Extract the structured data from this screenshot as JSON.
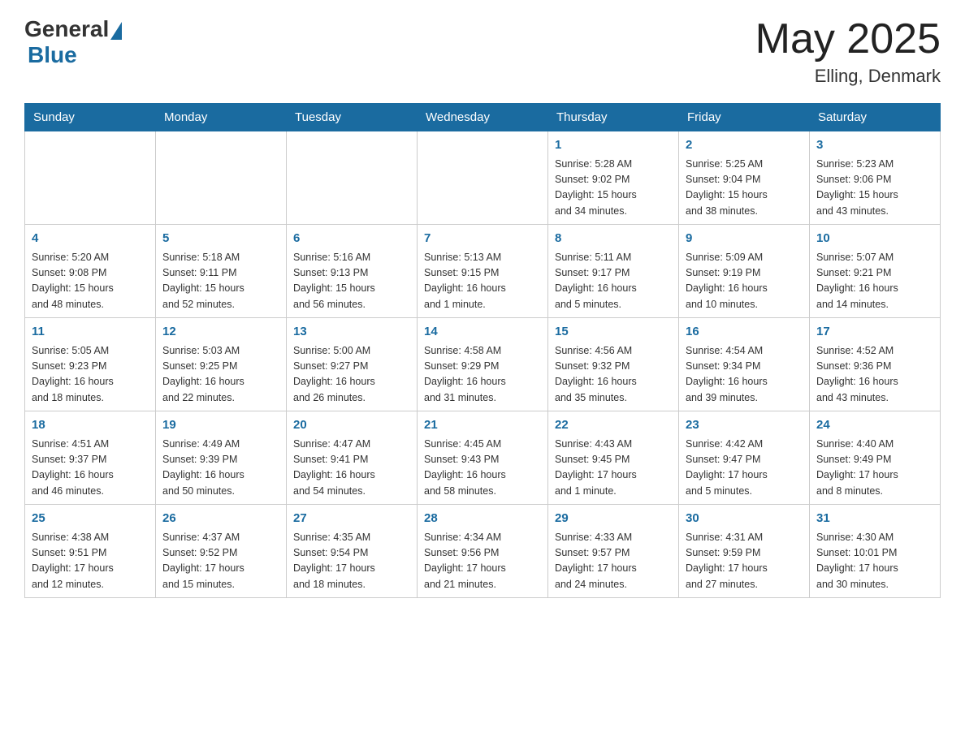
{
  "header": {
    "logo_general": "General",
    "logo_blue": "Blue",
    "month_year": "May 2025",
    "location": "Elling, Denmark"
  },
  "days_of_week": [
    "Sunday",
    "Monday",
    "Tuesday",
    "Wednesday",
    "Thursday",
    "Friday",
    "Saturday"
  ],
  "weeks": [
    [
      {
        "day": "",
        "info": ""
      },
      {
        "day": "",
        "info": ""
      },
      {
        "day": "",
        "info": ""
      },
      {
        "day": "",
        "info": ""
      },
      {
        "day": "1",
        "info": "Sunrise: 5:28 AM\nSunset: 9:02 PM\nDaylight: 15 hours\nand 34 minutes."
      },
      {
        "day": "2",
        "info": "Sunrise: 5:25 AM\nSunset: 9:04 PM\nDaylight: 15 hours\nand 38 minutes."
      },
      {
        "day": "3",
        "info": "Sunrise: 5:23 AM\nSunset: 9:06 PM\nDaylight: 15 hours\nand 43 minutes."
      }
    ],
    [
      {
        "day": "4",
        "info": "Sunrise: 5:20 AM\nSunset: 9:08 PM\nDaylight: 15 hours\nand 48 minutes."
      },
      {
        "day": "5",
        "info": "Sunrise: 5:18 AM\nSunset: 9:11 PM\nDaylight: 15 hours\nand 52 minutes."
      },
      {
        "day": "6",
        "info": "Sunrise: 5:16 AM\nSunset: 9:13 PM\nDaylight: 15 hours\nand 56 minutes."
      },
      {
        "day": "7",
        "info": "Sunrise: 5:13 AM\nSunset: 9:15 PM\nDaylight: 16 hours\nand 1 minute."
      },
      {
        "day": "8",
        "info": "Sunrise: 5:11 AM\nSunset: 9:17 PM\nDaylight: 16 hours\nand 5 minutes."
      },
      {
        "day": "9",
        "info": "Sunrise: 5:09 AM\nSunset: 9:19 PM\nDaylight: 16 hours\nand 10 minutes."
      },
      {
        "day": "10",
        "info": "Sunrise: 5:07 AM\nSunset: 9:21 PM\nDaylight: 16 hours\nand 14 minutes."
      }
    ],
    [
      {
        "day": "11",
        "info": "Sunrise: 5:05 AM\nSunset: 9:23 PM\nDaylight: 16 hours\nand 18 minutes."
      },
      {
        "day": "12",
        "info": "Sunrise: 5:03 AM\nSunset: 9:25 PM\nDaylight: 16 hours\nand 22 minutes."
      },
      {
        "day": "13",
        "info": "Sunrise: 5:00 AM\nSunset: 9:27 PM\nDaylight: 16 hours\nand 26 minutes."
      },
      {
        "day": "14",
        "info": "Sunrise: 4:58 AM\nSunset: 9:29 PM\nDaylight: 16 hours\nand 31 minutes."
      },
      {
        "day": "15",
        "info": "Sunrise: 4:56 AM\nSunset: 9:32 PM\nDaylight: 16 hours\nand 35 minutes."
      },
      {
        "day": "16",
        "info": "Sunrise: 4:54 AM\nSunset: 9:34 PM\nDaylight: 16 hours\nand 39 minutes."
      },
      {
        "day": "17",
        "info": "Sunrise: 4:52 AM\nSunset: 9:36 PM\nDaylight: 16 hours\nand 43 minutes."
      }
    ],
    [
      {
        "day": "18",
        "info": "Sunrise: 4:51 AM\nSunset: 9:37 PM\nDaylight: 16 hours\nand 46 minutes."
      },
      {
        "day": "19",
        "info": "Sunrise: 4:49 AM\nSunset: 9:39 PM\nDaylight: 16 hours\nand 50 minutes."
      },
      {
        "day": "20",
        "info": "Sunrise: 4:47 AM\nSunset: 9:41 PM\nDaylight: 16 hours\nand 54 minutes."
      },
      {
        "day": "21",
        "info": "Sunrise: 4:45 AM\nSunset: 9:43 PM\nDaylight: 16 hours\nand 58 minutes."
      },
      {
        "day": "22",
        "info": "Sunrise: 4:43 AM\nSunset: 9:45 PM\nDaylight: 17 hours\nand 1 minute."
      },
      {
        "day": "23",
        "info": "Sunrise: 4:42 AM\nSunset: 9:47 PM\nDaylight: 17 hours\nand 5 minutes."
      },
      {
        "day": "24",
        "info": "Sunrise: 4:40 AM\nSunset: 9:49 PM\nDaylight: 17 hours\nand 8 minutes."
      }
    ],
    [
      {
        "day": "25",
        "info": "Sunrise: 4:38 AM\nSunset: 9:51 PM\nDaylight: 17 hours\nand 12 minutes."
      },
      {
        "day": "26",
        "info": "Sunrise: 4:37 AM\nSunset: 9:52 PM\nDaylight: 17 hours\nand 15 minutes."
      },
      {
        "day": "27",
        "info": "Sunrise: 4:35 AM\nSunset: 9:54 PM\nDaylight: 17 hours\nand 18 minutes."
      },
      {
        "day": "28",
        "info": "Sunrise: 4:34 AM\nSunset: 9:56 PM\nDaylight: 17 hours\nand 21 minutes."
      },
      {
        "day": "29",
        "info": "Sunrise: 4:33 AM\nSunset: 9:57 PM\nDaylight: 17 hours\nand 24 minutes."
      },
      {
        "day": "30",
        "info": "Sunrise: 4:31 AM\nSunset: 9:59 PM\nDaylight: 17 hours\nand 27 minutes."
      },
      {
        "day": "31",
        "info": "Sunrise: 4:30 AM\nSunset: 10:01 PM\nDaylight: 17 hours\nand 30 minutes."
      }
    ]
  ]
}
